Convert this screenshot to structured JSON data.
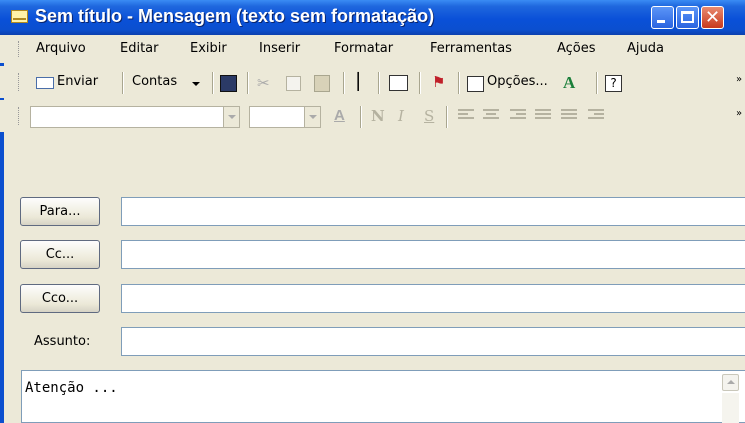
{
  "window": {
    "title": "Sem título - Mensagem (texto sem formatação)",
    "controls": [
      "minimize",
      "maximize",
      "close"
    ]
  },
  "menu": [
    "Arquivo",
    "Editar",
    "Exibir",
    "Inserir",
    "Formatar",
    "Ferramentas",
    "Ações",
    "Ajuda"
  ],
  "standard_toolbar": {
    "send": "Enviar",
    "accounts": "Contas",
    "options": "Opções...",
    "overflow": "»"
  },
  "formatting_toolbar": {
    "font_name": "",
    "font_size": "",
    "font_color": "A",
    "bold": "N",
    "italic": "I",
    "underline": "S",
    "overflow": "»"
  },
  "fields": {
    "to_button": "Para...",
    "to_value": "",
    "cc_button": "Cc...",
    "cc_value": "",
    "bcc_button": "Cco...",
    "bcc_value": "",
    "subject_label": "Assunto:",
    "subject_value": ""
  },
  "body": {
    "text": "Atenção ..."
  },
  "colors": {
    "titlebar": "#0b4fcf",
    "window_bg": "#ece9d8",
    "close_button": "#c8391d",
    "input_border": "#7f9db9"
  }
}
